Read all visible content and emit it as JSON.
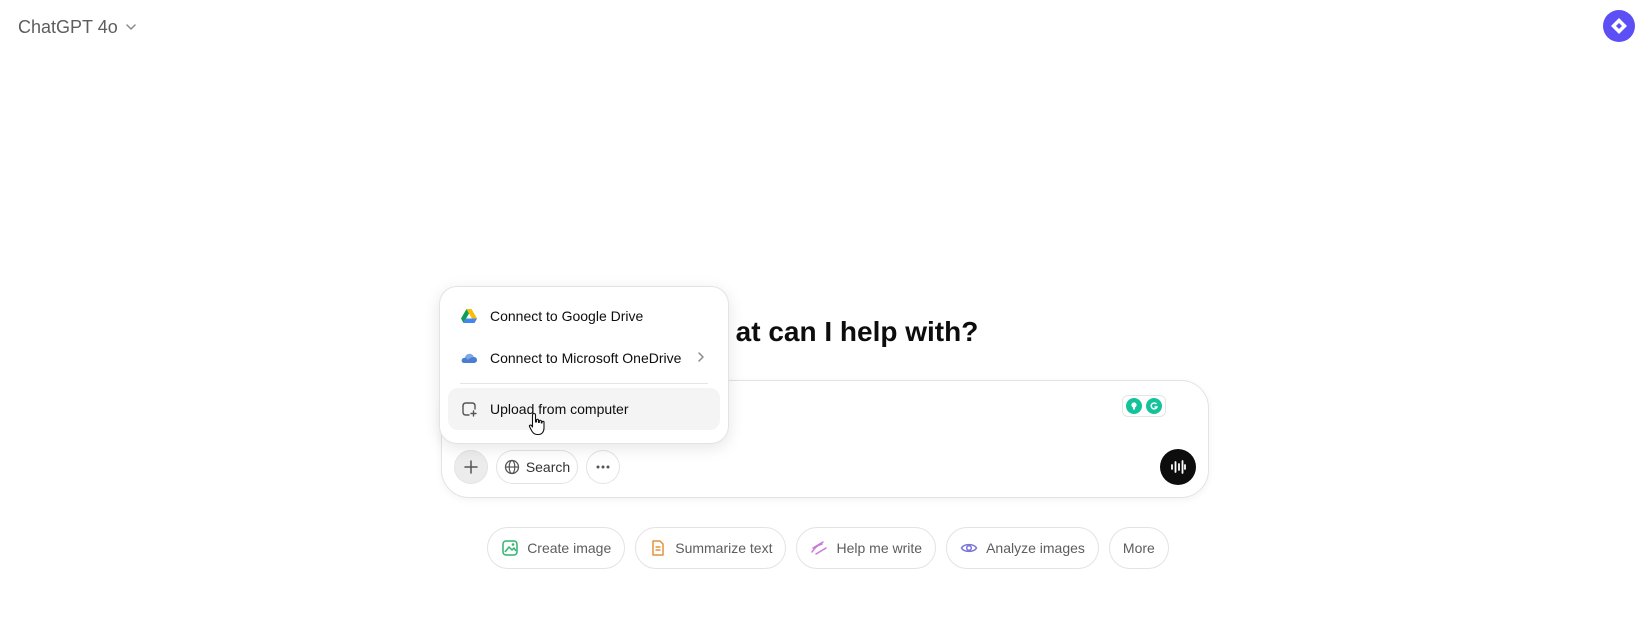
{
  "header": {
    "model_name": "ChatGPT 4o"
  },
  "main": {
    "headline": "at can I help with?"
  },
  "composer": {
    "placeholder": "",
    "search_label": "Search"
  },
  "attach_menu": {
    "items": [
      {
        "label": "Connect to Google Drive",
        "icon": "google-drive-icon"
      },
      {
        "label": "Connect to Microsoft OneDrive",
        "icon": "onedrive-icon",
        "has_submenu": true
      },
      {
        "label": "Upload from computer",
        "icon": "upload-file-icon",
        "hovered": true
      }
    ]
  },
  "suggestions": [
    {
      "label": "Create image",
      "icon": "image-icon",
      "color": "#2fb56f"
    },
    {
      "label": "Summarize text",
      "icon": "document-icon",
      "color": "#e2923b"
    },
    {
      "label": "Help me write",
      "icon": "pen-icon",
      "color": "#c77ad8"
    },
    {
      "label": "Analyze images",
      "icon": "eye-icon",
      "color": "#7a74d6"
    },
    {
      "label": "More",
      "icon": "",
      "color": ""
    }
  ],
  "colors": {
    "accent": "#5b4ff5",
    "voice_button": "#0d0d0d"
  }
}
